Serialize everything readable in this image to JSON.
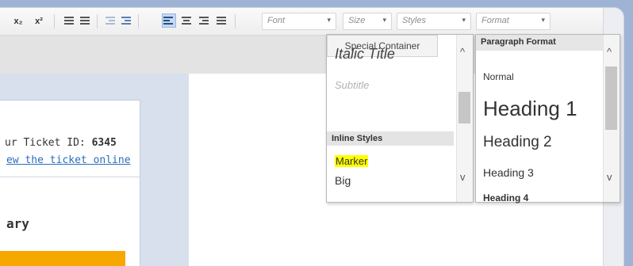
{
  "toolbar": {
    "subscript_label": "x₂",
    "superscript_label": "x²",
    "font_combo": {
      "label": "Font",
      "arrow": "▾"
    },
    "size_combo": {
      "label": "Size",
      "arrow": "▾"
    },
    "styles_combo": {
      "label": "Styles",
      "arrow": "▾"
    },
    "format_combo": {
      "label": "Format",
      "arrow": "▾"
    }
  },
  "document": {
    "ticket_prefix": "ur Ticket ID: ",
    "ticket_id": "6345",
    "view_link": "ew the ticket online",
    "summary_heading": "ary",
    "accent_color": "#f6a800"
  },
  "styles_panel": {
    "items": {
      "italic_title": "Italic Title",
      "subtitle": "Subtitle",
      "special_container": "Special Container"
    },
    "inline_header": "Inline Styles",
    "inline_items": {
      "marker": "Marker",
      "big": "Big"
    },
    "scroll": {
      "up": "^",
      "down": "v"
    }
  },
  "format_panel": {
    "header": "Paragraph Format",
    "items": {
      "normal": "Normal",
      "heading1": "Heading 1",
      "heading2": "Heading 2",
      "heading3": "Heading 3",
      "heading4": "Heading 4"
    },
    "scroll": {
      "up": "^",
      "down": "v"
    }
  }
}
